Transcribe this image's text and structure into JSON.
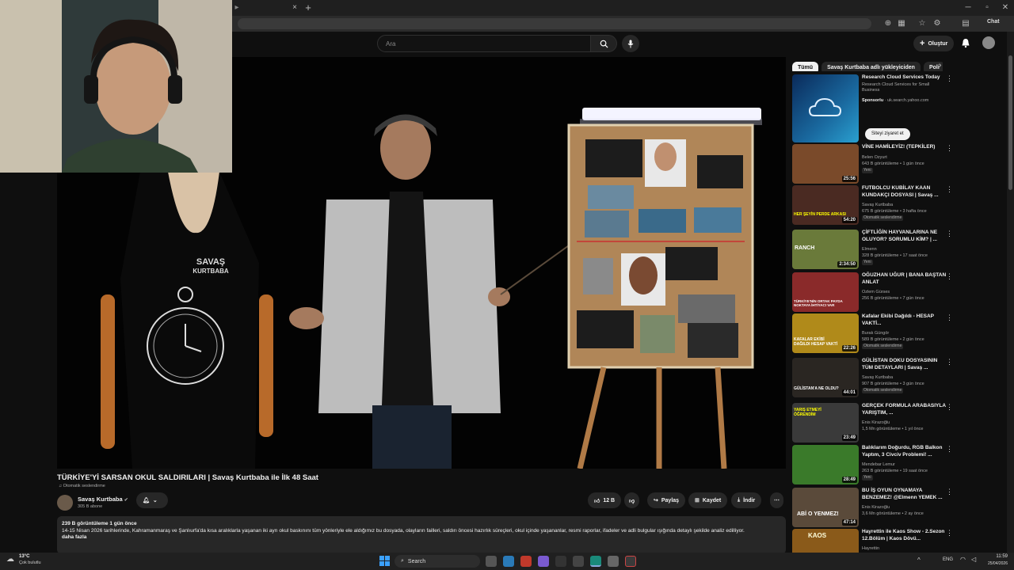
{
  "browser": {
    "new_tab": "+",
    "close_tab": "×",
    "profile_name": "Chat"
  },
  "header": {
    "search_placeholder": "Ara",
    "create_label": "Oluştur"
  },
  "chips": [
    "Tümü",
    "Savaş Kurtbaba adlı yükleyiciden",
    "Poli"
  ],
  "video": {
    "title": "TÜRKİYE'Yİ SARSAN OKUL SALDIRILARI | Savaş Kurtbaba ile İlk 48 Saat",
    "auto_dub": "Otomatik seslendirme",
    "channel": "Savaş Kurtbaba",
    "subscribers": "305 B abone",
    "likes": "12 B",
    "share": "Paylaş",
    "save": "Kaydet",
    "download": "İndir",
    "views_date": "239 B görüntüleme  1 gün önce",
    "description": "14-15 Nisan 2026 tarihlerinde, Kahramanmaraş ve Şanlıurfa'da kısa aralıklarla yaşanan iki ayrı okul baskınını tüm yönleriyle ele aldığımız bu dosyada, olayların failleri, saldırı öncesi hazırlık süreçleri, okul içinde yaşananlar, resmi raporlar, ifadeler ve adli bulgular ışığında detaylı şekilde analiz edilliyor.",
    "more": "daha fazla",
    "shirt_text_1": "SAVAŞ",
    "shirt_text_2": "KURTBABA"
  },
  "ad": {
    "title": "Research Cloud Services Today",
    "subtitle": "Research Cloud Services for Small Business",
    "sponsored": "Sponsorlu",
    "domain": "uk.search.yahoo.com",
    "cta": "Siteyi ziyaret et"
  },
  "recommendations": [
    {
      "title": "VİNE HAMİLEYİZ! (TEPKİLER)",
      "channel": "Belen Özyurt",
      "meta": "643 B görüntüleme • 1 gün önce",
      "badge": "Yeni",
      "duration": "25:56",
      "thumb_color": "#7a4a2a"
    },
    {
      "title": "FUTBOLCU KUBİLAY KAAN KUNDAKÇI DOSYASI | Savaş ...",
      "channel": "Savaş Kurtbaba",
      "meta": "675 B görüntüleme • 3 hafta önce",
      "badge": "Otomatik seslendirme",
      "duration": "54:20",
      "thumb_color": "#4a2a22"
    },
    {
      "title": "ÇİFTLİĞİN HAYVANLARINA NE OLUYOR? SORUMLU KİM? | ...",
      "channel": "Elmenn",
      "meta": "328 B görüntüleme • 17 saat önce",
      "badge": "Yeni",
      "duration": "2:34:50",
      "thumb_color": "#6a7a3a"
    },
    {
      "title": "OĞUZHAN UĞUR | BANA BAŞTAN ANLAT",
      "channel": "Özlem Gürses",
      "meta": "256 B görüntüleme • 7 gün önce",
      "badge": "",
      "duration": "",
      "thumb_color": "#8a2a2a"
    },
    {
      "title": "Kafalar Ekibi Dağıldı - HESAP VAKTİ...",
      "channel": "Burak Güngör",
      "meta": "589 B görüntüleme • 2 gün önce",
      "badge": "Otomatik seslendirme",
      "duration": "22:26",
      "thumb_color": "#b08a1a"
    },
    {
      "title": "GÜLİSTAN DOKU DOSYASININ TÜM DETAYLARI | Savaş ...",
      "channel": "Savaş Kurtbaba",
      "meta": "907 B görüntüleme • 3 gün önce",
      "badge": "Otomatik seslendirme",
      "duration": "44:01",
      "thumb_color": "#2a2622"
    },
    {
      "title": "GERÇEK FORMULA ARABASIYLA YARIŞTIM, ...",
      "channel": "Enis Kirazoğlu",
      "meta": "1,5 Mn görüntüleme • 1 yıl önce",
      "badge": "",
      "duration": "23:49",
      "thumb_color": "#3a3a3a"
    },
    {
      "title": "Balıklarım Doğurdu, RGB Balkon Yaptım, 3 Civciv Problemi! ...",
      "channel": "Mendebar Lemur",
      "meta": "263 B görüntüleme • 19 saat önce",
      "badge": "Yeni",
      "duration": "28:49",
      "thumb_color": "#3a7a2a"
    },
    {
      "title": "BU İŞ OYUN OYNAMAYA BENZEMEZ! @Elmenn YEMEK ...",
      "channel": "Enis Kirazoğlu",
      "meta": "3,6 Mn görüntüleme • 2 ay önce",
      "badge": "",
      "duration": "47:14",
      "thumb_color": "#5a4a3a"
    },
    {
      "title": "Hayrettin ile Kaos Show - 2.Sezon 12.Bölüm | Kaos Dövü...",
      "channel": "Hayrettin",
      "meta": "",
      "badge": "",
      "duration": "",
      "thumb_color": "#8a5a1a"
    }
  ],
  "rec_thumb_text": {
    "r1": "HER ŞEYİN PERDE ARKASI",
    "r2": "RANCH",
    "r3": "TÜRKİYE'NİN ORTAK PAYDA NOKTAYA İHTİYACI VAR",
    "r4": "KAFALAR EKİBİ DAĞILDI HESAP VAKTİ",
    "r5": "GÜLİSTAN'A NE OLDU?",
    "r6": "YARIŞ ETMEYİ ÖĞRENDİM",
    "r8": "ABİ O YENMEZ!",
    "r9": "KAOS"
  },
  "taskbar": {
    "weather_temp": "13°C",
    "weather_desc": "Çok bulutlu",
    "search": "Search",
    "lang": "ENG",
    "time": "11:59",
    "date": "25/04/2026"
  }
}
